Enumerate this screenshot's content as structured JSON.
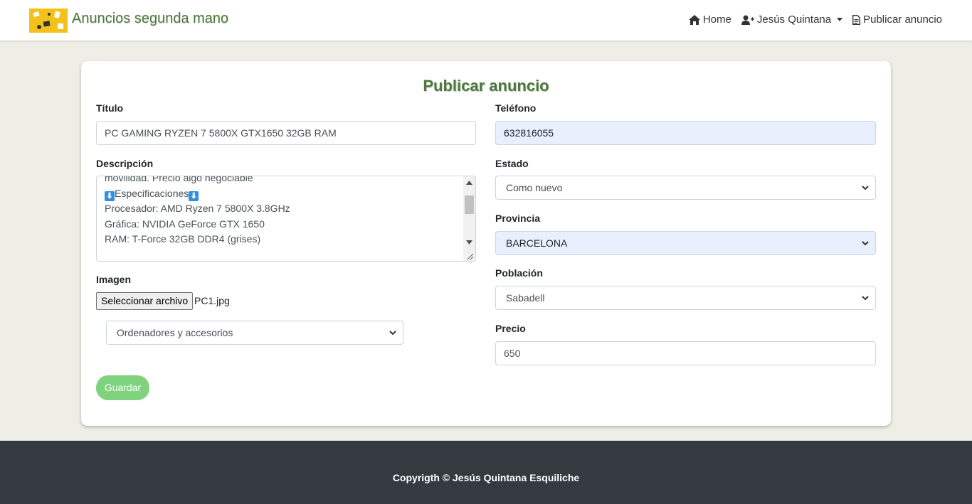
{
  "header": {
    "brand": "Anuncios segunda mano",
    "nav": {
      "home": "Home",
      "user": "Jesús Quintana",
      "publish": "Publicar anuncio"
    }
  },
  "form": {
    "title": "Publicar anuncio",
    "titulo": {
      "label": "Título",
      "value": "PC GAMING RYZEN 7 5800X GTX1650 32GB RAM"
    },
    "descripcion": {
      "label": "Descripción",
      "lines": [
        "movilidad. Precio algo negociable",
        "",
        "Especificaciones",
        "Procesador: AMD Ryzen 7 5800X 3.8GHz",
        "Gráfica: NVIDIA GeForce GTX 1650",
        "RAM: T-Force 32GB DDR4 (grises)"
      ]
    },
    "imagen": {
      "label": "Imagen",
      "button": "Seleccionar archivo",
      "file": "PC1.jpg"
    },
    "categoria": {
      "value": "Ordenadores y accesorios"
    },
    "telefono": {
      "label": "Teléfono",
      "value": "632816055"
    },
    "estado": {
      "label": "Estado",
      "value": "Como nuevo"
    },
    "provincia": {
      "label": "Provincia",
      "value": "BARCELONA"
    },
    "poblacion": {
      "label": "Población",
      "value": "Sabadell"
    },
    "precio": {
      "label": "Precio",
      "value": "650"
    },
    "save": "Guardar"
  },
  "footer": {
    "text": "Copyrigth © Jesús Quintana Esquiliche"
  },
  "colors": {
    "brand_green": "#4a7a3a",
    "save_button": "#7fd37f",
    "footer_bg": "#343a40",
    "autofill": "#e8f0fe"
  }
}
